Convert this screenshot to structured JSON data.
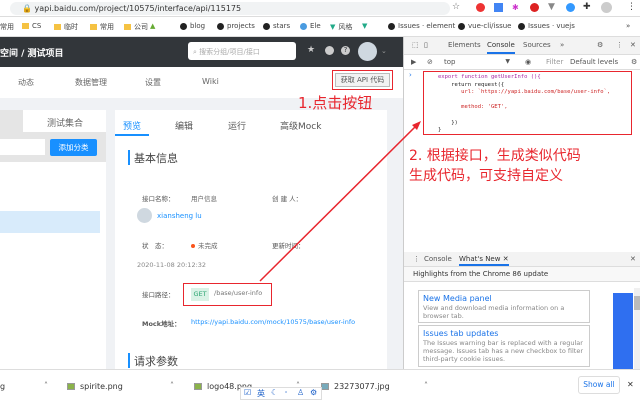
{
  "browser": {
    "url": "yapi.baidu.com/project/10575/interface/api/115175",
    "bookmarks": [
      "常用",
      "CS",
      "临时",
      "常用",
      "公司",
      "blog",
      "projects",
      "stars",
      "Ele",
      "风格",
      "Issues · element",
      "vue-cli/issue",
      "Issues · vuejs"
    ]
  },
  "header": {
    "breadcrumb": "空间 / 测试项目",
    "search_placeholder": "搜索分组/项目/接口"
  },
  "nav": {
    "tabs": [
      "动态",
      "数据管理",
      "设置",
      "Wiki"
    ],
    "api_code_button": "获取 API 代码"
  },
  "left": {
    "tab": "测试集合",
    "add_button": "添加分类"
  },
  "main": {
    "tabs": [
      "预览",
      "编辑",
      "运行",
      "高级Mock"
    ],
    "section1": "基本信息",
    "name_label": "接口名称：",
    "name_value": "用户信息",
    "creator_label": "创 建 人：",
    "creator_name": "xiansheng lu",
    "status_label": "状　态：",
    "status_value": "未完成",
    "update_label": "更新时间：",
    "update_time": "2020-11-08 20:12:32",
    "path_label": "接口路径：",
    "method": "GET",
    "path": "/base/user-info",
    "mock_label": "Mock地址：",
    "mock_url": "https://yapi.baidu.com/mock/10575/base/user-info",
    "section2": "请求参数"
  },
  "annotations": {
    "step1": "1.点击按钮",
    "step2_line1": "2. 根据接口，生成类似代码",
    "step2_line2": "生成代码，可支持自定义"
  },
  "devtools": {
    "tabs": [
      "Elements",
      "Console",
      "Sources"
    ],
    "context": "top",
    "filter_placeholder": "Filter",
    "levels": "Default levels",
    "code": [
      "export function getUserInfo (){",
      "    return request({",
      "       url: `https://yapi.baidu.com/base/user-info`,",
      "",
      "       method: 'GET',",
      "",
      "    })",
      "}"
    ],
    "drawer_tabs": [
      "Console",
      "What's New"
    ],
    "highlights": "Highlights from the Chrome 86 update",
    "cards": [
      {
        "title": "New Media panel",
        "text": "View and download media information on a browser tab."
      },
      {
        "title": "Issues tab updates",
        "text": "The Issues warning bar is replaced with a regular message. Issues tab has a new checkbox to filter third-party cookie issues."
      }
    ]
  },
  "downloads": {
    "items": [
      "g",
      "spirite.png",
      "logo48.png",
      "23273077.jpg"
    ],
    "show_all": "Show all"
  },
  "ime": {
    "lang": "英"
  },
  "colors": {
    "accent": "#1890ff",
    "annotation": "#e8262e",
    "header": "#32363a"
  }
}
